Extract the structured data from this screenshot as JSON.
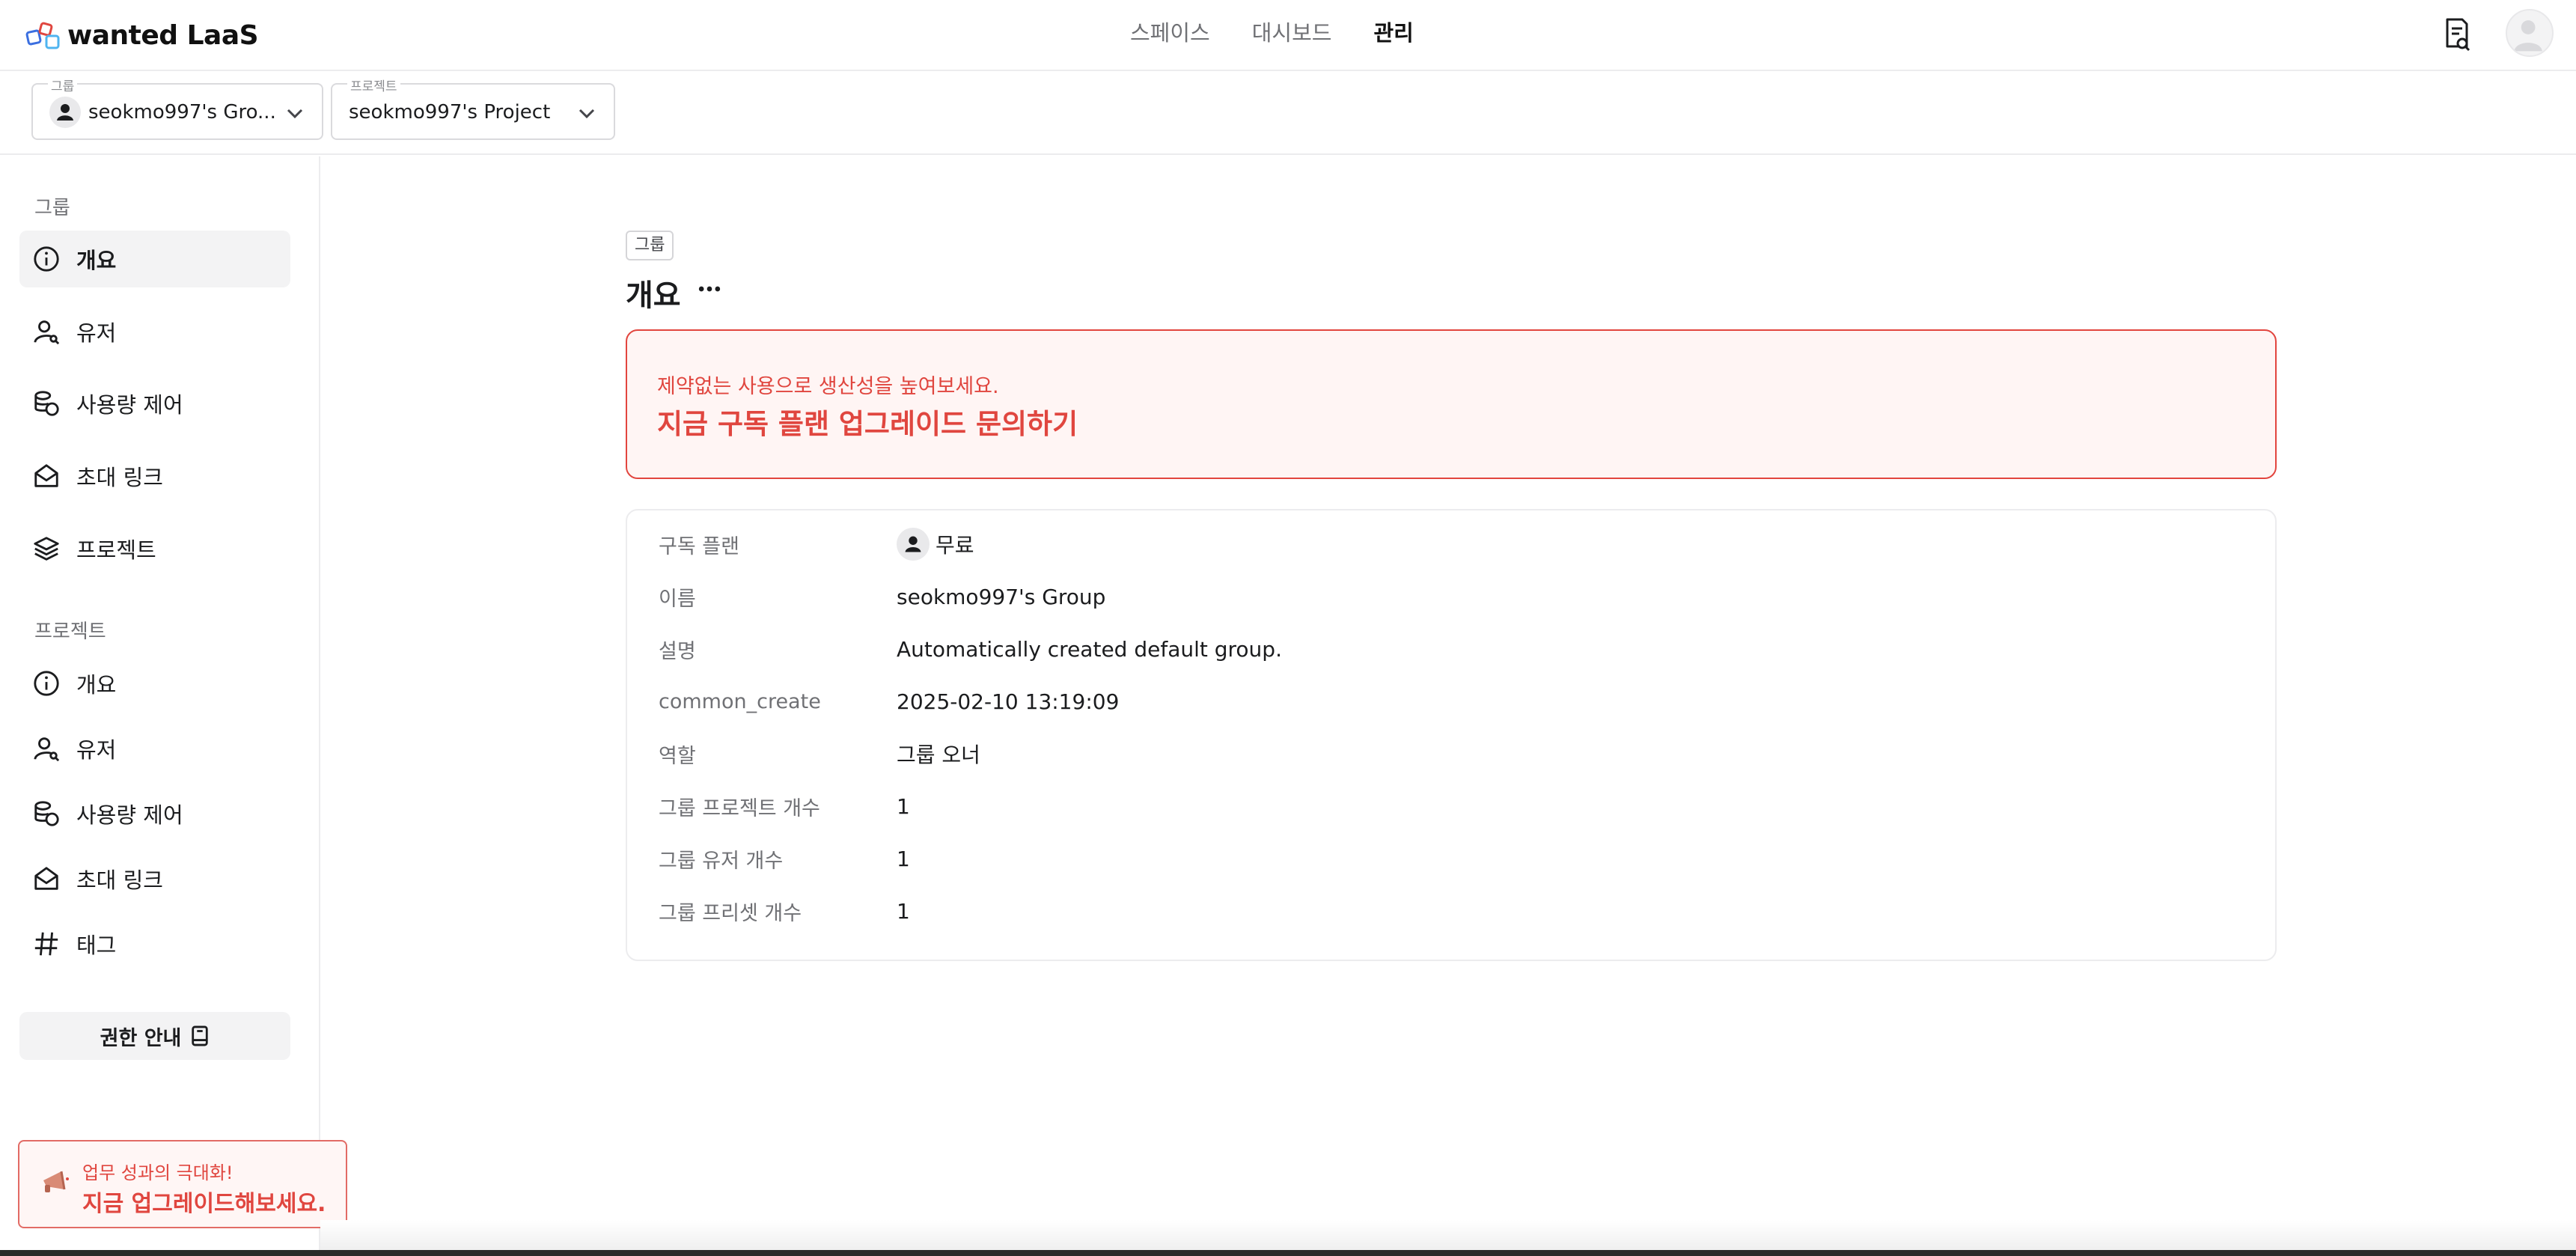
{
  "app": {
    "logo_text": "wanted LaaS"
  },
  "nav": {
    "links": [
      {
        "label": "스페이스",
        "active": false
      },
      {
        "label": "대시보드",
        "active": false
      },
      {
        "label": "관리",
        "active": true
      }
    ]
  },
  "selectors": {
    "group": {
      "legend": "그룹",
      "value": "seokmo997's Gro..."
    },
    "project": {
      "legend": "프로젝트",
      "value": "seokmo997's Project"
    }
  },
  "sidebar": {
    "group_section": "그룹",
    "group_items": [
      {
        "label": "개요",
        "icon": "info-icon",
        "active": true
      },
      {
        "label": "유저",
        "icon": "user-icon",
        "active": false
      },
      {
        "label": "사용량 제어",
        "icon": "coins-icon",
        "active": false
      },
      {
        "label": "초대 링크",
        "icon": "mail-open-icon",
        "active": false
      },
      {
        "label": "프로젝트",
        "icon": "layers-icon",
        "active": false
      }
    ],
    "project_section": "프로젝트",
    "project_items": [
      {
        "label": "개요",
        "icon": "info-icon"
      },
      {
        "label": "유저",
        "icon": "user-icon"
      },
      {
        "label": "사용량 제어",
        "icon": "coins-icon"
      },
      {
        "label": "초대 링크",
        "icon": "mail-open-icon"
      },
      {
        "label": "태그",
        "icon": "hash-icon"
      }
    ],
    "permission_button": "권한 안내",
    "promo": {
      "sub": "업무 성과의 극대화!",
      "main": "지금 업그레이드해보세요."
    }
  },
  "main": {
    "badge": "그룹",
    "title": "개요",
    "banner": {
      "sub": "제약없는 사용으로 생산성을 높여보세요.",
      "main": "지금 구독 플랜 업그레이드 문의하기"
    },
    "details": [
      {
        "key": "구독 플랜",
        "value": "무료"
      },
      {
        "key": "이름",
        "value": "seokmo997's Group"
      },
      {
        "key": "설명",
        "value": "Automatically created default group."
      },
      {
        "key": "common_create",
        "value": "2025-02-10 13:19:09"
      },
      {
        "key": "역할",
        "value": "그룹 오너"
      },
      {
        "key": "그룹 프로젝트 개수",
        "value": "1"
      },
      {
        "key": "그룹 유저 개수",
        "value": "1"
      },
      {
        "key": "그룹 프리셋 개수",
        "value": "1"
      }
    ]
  },
  "colors": {
    "accent_red": "#e0463f",
    "banner_bg": "#fff5f4",
    "border": "#ececee"
  }
}
